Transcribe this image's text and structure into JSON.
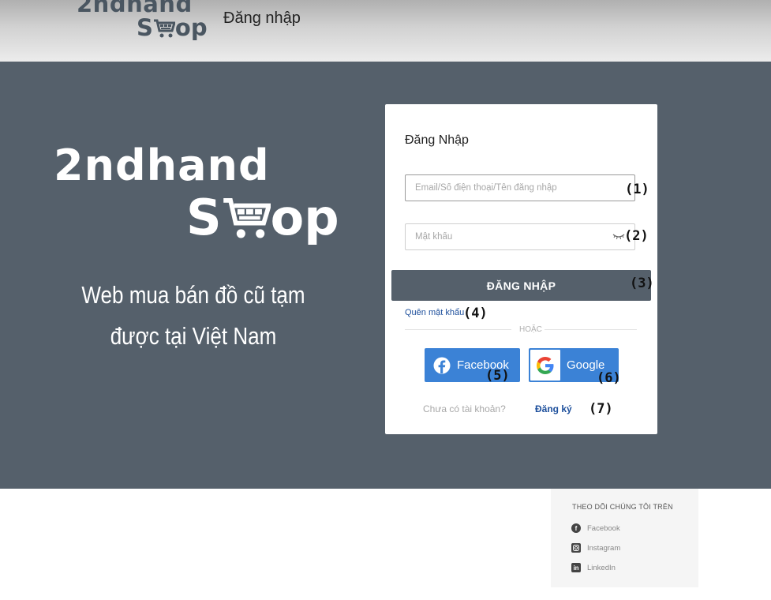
{
  "brand": {
    "line1": "2ndhand",
    "line2_pre": "S",
    "line2_post": "op"
  },
  "header": {
    "title": "Đăng nhập"
  },
  "hero": {
    "tagline_line1": "Web mua bán đồ cũ tạm",
    "tagline_line2": "được tại Việt Nam"
  },
  "login": {
    "title": "Đăng Nhập",
    "email_placeholder": "Email/Số điện thoại/Tên đăng nhập",
    "password_placeholder": "Mật khẩu",
    "submit_label": "ĐĂNG NHẬP",
    "forgot_label": "Quên mật khẩu",
    "or_label": "HOẶC",
    "facebook_label": "Facebook",
    "google_label": "Google",
    "no_account_text": "Chưa có tài khoản?",
    "register_label": "Đăng ký"
  },
  "annotations": [
    "(1)",
    "(2)",
    "(3)",
    "(4)",
    "(5)",
    "(6)",
    "(7)"
  ],
  "follow": {
    "title": "THEO DÕI CHÚNG TÔI TRÊN",
    "items": [
      {
        "icon": "facebook-icon",
        "label": "Facebook"
      },
      {
        "icon": "instagram-icon",
        "label": "Instagram"
      },
      {
        "icon": "linkedin-icon",
        "label": "LinkedIn"
      }
    ]
  },
  "colors": {
    "primary": "#55606b",
    "social_blue": "#3b82d6",
    "link": "#1d4f9c"
  }
}
